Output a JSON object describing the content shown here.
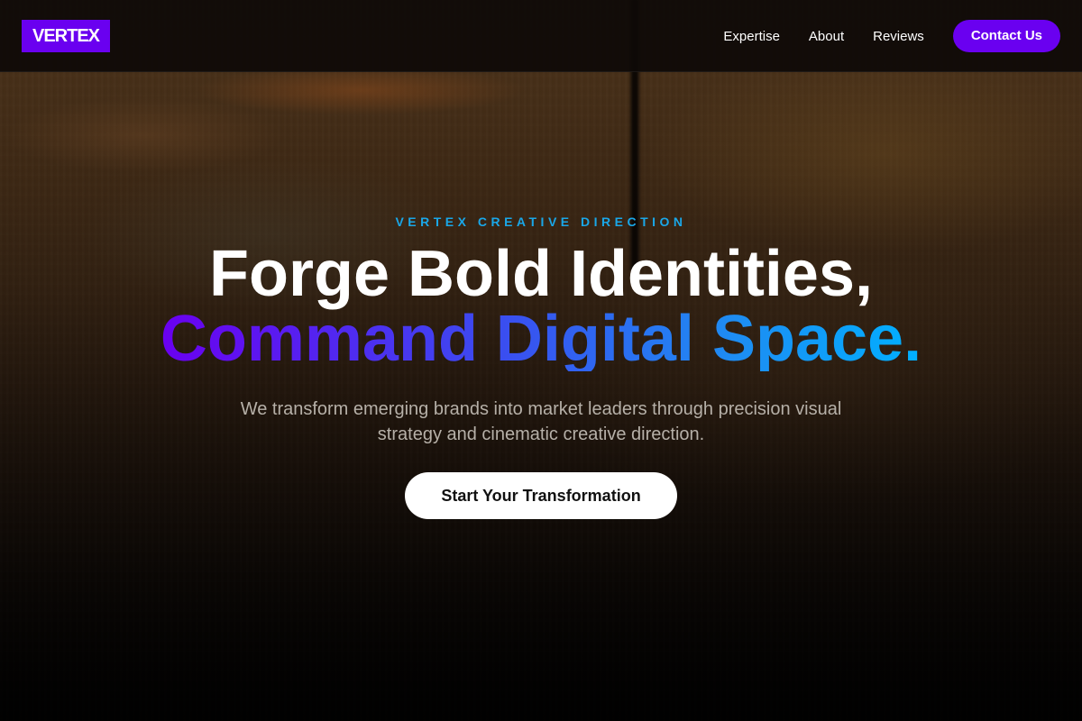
{
  "brand": {
    "logo_text": "VERTEX",
    "accent_color": "#6a00f0"
  },
  "nav": {
    "links": [
      {
        "label": "Expertise"
      },
      {
        "label": "About"
      },
      {
        "label": "Reviews"
      }
    ],
    "contact_label": "Contact Us"
  },
  "hero": {
    "eyebrow": "VERTEX CREATIVE DIRECTION",
    "eyebrow_color": "#1aa7e8",
    "headline_line1": "Forge Bold Identities,",
    "headline_line2": "Command Digital Space.",
    "subtitle": "We transform emerging brands into market leaders through precision visual strategy and cinematic creative direction.",
    "cta_label": "Start Your Transformation"
  }
}
